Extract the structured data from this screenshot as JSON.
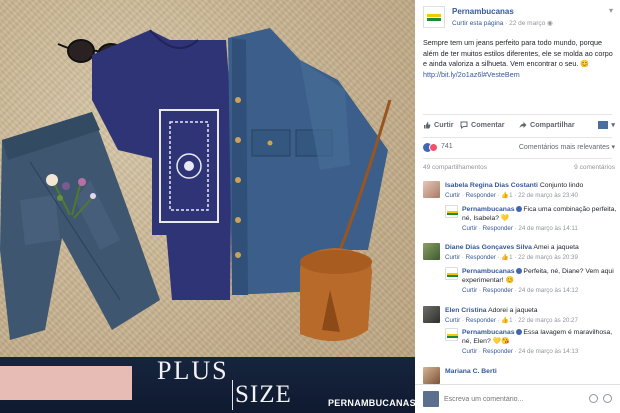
{
  "photo": {
    "plus_label": "PLUS",
    "size_label": "SIZE",
    "brand_label": "PERNAMBUCANAS"
  },
  "post": {
    "page_name": "Pernambucanas",
    "follow_label": "Curtir esta página",
    "date": "22 de março",
    "text": "Sempre tem um jeans perfeito para todo mundo, porque além de ter muitos estilos diferentes, ele se molda ao corpo e ainda valoriza a silhueta. Vem encontrar o seu. ",
    "link": "http://bit.ly/2o1az6l",
    "hashtag": "#VesteBem",
    "actions": {
      "like": "Curtir",
      "comment": "Comentar",
      "share": "Compartilhar"
    },
    "reaction_count": "741",
    "sort_label": "Comentários mais relevantes",
    "shares": "49 compartilhamentos",
    "comments_count": "9 comentários"
  },
  "comments": [
    {
      "name": "Isabela Regina Dias Costanti",
      "text": "Conjunto lindo",
      "like": "Curtir",
      "reply": "Responder",
      "likes": "1",
      "time": "22 de março às 23:40",
      "reply_item": {
        "name": "Pernambucanas",
        "text": "Fica uma combinação perfeita, né, Isabela? 💛",
        "like": "Curtir",
        "reply": "Responder",
        "time": "24 de março às 14:11"
      }
    },
    {
      "name": "Diane Dias Gonçaves Silva",
      "text": "Amei a jaqueta",
      "like": "Curtir",
      "reply": "Responder",
      "likes": "1",
      "time": "22 de março às 20:39",
      "reply_item": {
        "name": "Pernambucanas",
        "text": "Perfeita, né, Diane? Vem aqui experimentar! 😊",
        "like": "Curtir",
        "reply": "Responder",
        "time": "24 de março às 14:12"
      }
    },
    {
      "name": "Elen Cristina",
      "text": "Adorei a jaqueta",
      "like": "Curtir",
      "reply": "Responder",
      "likes": "1",
      "time": "22 de março às 20:27",
      "reply_item": {
        "name": "Pernambucanas",
        "text": "Essa lavagem é maravilhosa, né, Elen? 💛😘",
        "like": "Curtir",
        "reply": "Responder",
        "time": "24 de março às 14:13"
      }
    },
    {
      "name": "Mariana C. Berti"
    }
  ],
  "comment_box": {
    "placeholder": "Escreva um comentário..."
  },
  "colors": {
    "facebook_blue": "#365899",
    "brand_green": "#1b8a3b",
    "brand_yellow": "#f6c800"
  }
}
